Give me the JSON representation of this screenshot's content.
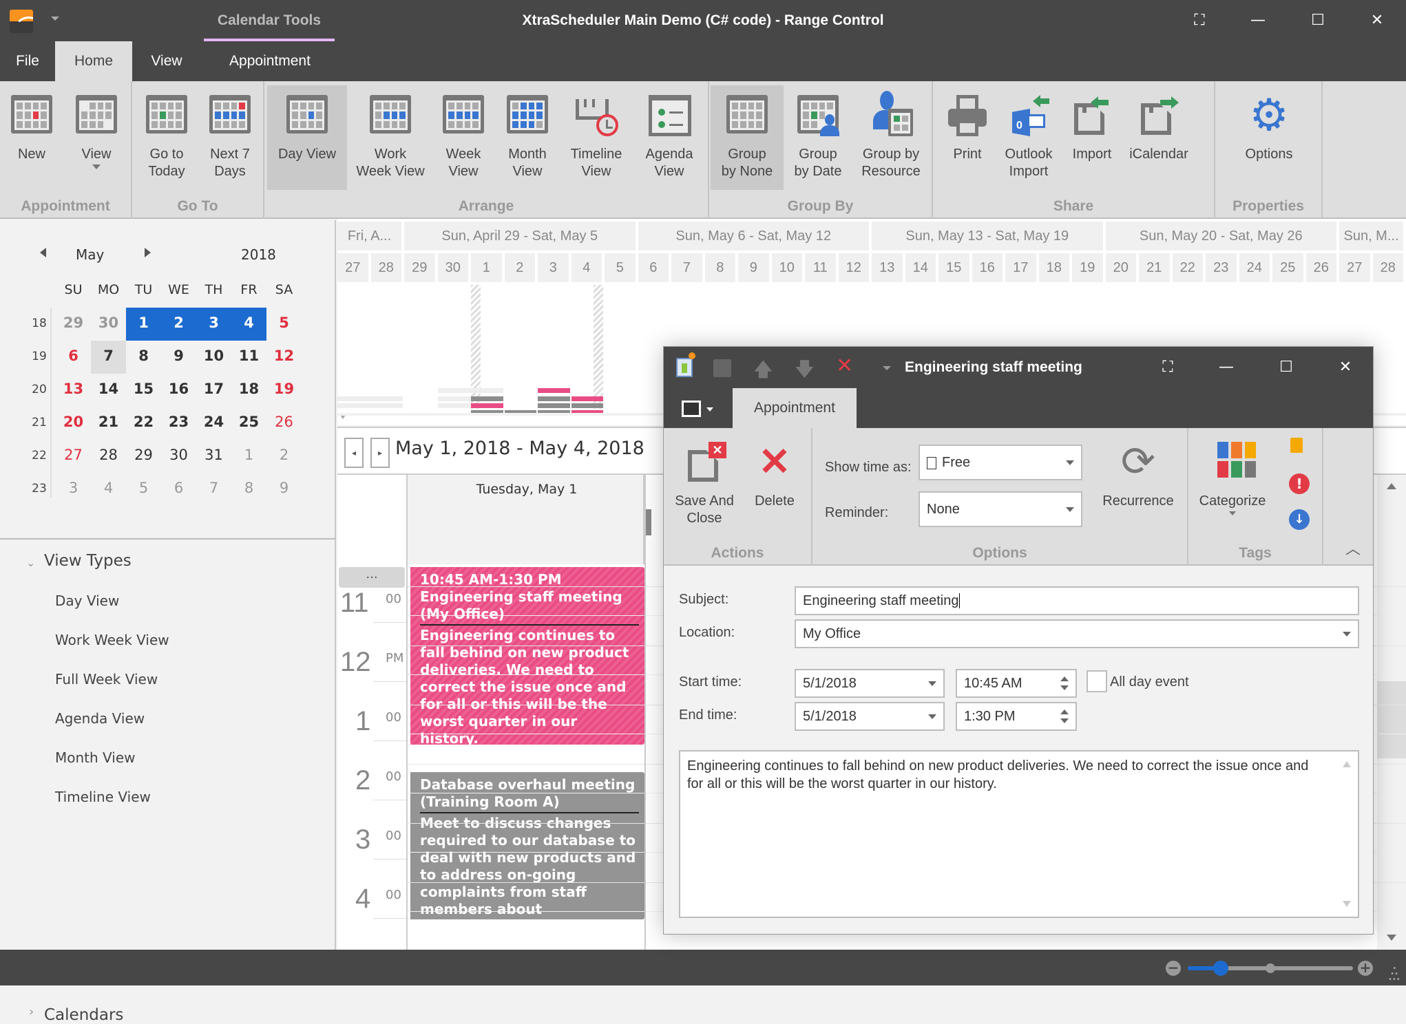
{
  "window": {
    "title": "XtraScheduler Main Demo (C# code) - Range Control",
    "context_tab": "Calendar Tools",
    "controls": {
      "focus": "⛶",
      "minimize": "—",
      "maximize": "☐",
      "close": "✕"
    }
  },
  "menu_tabs": [
    "File",
    "Home",
    "View",
    "Appointment"
  ],
  "ribbon": {
    "groups": [
      {
        "label": "Appointment",
        "buttons": [
          "New",
          "View"
        ]
      },
      {
        "label": "Go To",
        "buttons": [
          "Go to\nToday",
          "Next 7\nDays"
        ]
      },
      {
        "label": "Arrange",
        "buttons": [
          "Day View",
          "Work\nWeek View",
          "Week\nView",
          "Month\nView",
          "Timeline\nView",
          "Agenda\nView"
        ]
      },
      {
        "label": "Group By",
        "buttons": [
          "Group\nby None",
          "Group\nby Date",
          "Group by\nResource"
        ]
      },
      {
        "label": "Share",
        "buttons": [
          "Print",
          "Outlook\nImport",
          "Import",
          "iCalendar"
        ]
      },
      {
        "label": "Properties",
        "buttons": [
          "Options"
        ]
      }
    ],
    "selected": [
      "Day View",
      "Group by None"
    ]
  },
  "date_navigator": {
    "month": "May",
    "year": "2018",
    "weekdays": [
      "SU",
      "MO",
      "TU",
      "WE",
      "TH",
      "FR",
      "SA"
    ],
    "weeks": [
      {
        "num": "18",
        "days": [
          "29",
          "30",
          "1",
          "2",
          "3",
          "4",
          "5"
        ]
      },
      {
        "num": "19",
        "days": [
          "6",
          "7",
          "8",
          "9",
          "10",
          "11",
          "12"
        ]
      },
      {
        "num": "20",
        "days": [
          "13",
          "14",
          "15",
          "16",
          "17",
          "18",
          "19"
        ]
      },
      {
        "num": "21",
        "days": [
          "20",
          "21",
          "22",
          "23",
          "24",
          "25",
          "26"
        ]
      },
      {
        "num": "22",
        "days": [
          "27",
          "28",
          "29",
          "30",
          "31",
          "1",
          "2"
        ]
      },
      {
        "num": "23",
        "days": [
          "3",
          "4",
          "5",
          "6",
          "7",
          "8",
          "9"
        ]
      }
    ],
    "selected_range": "May 1 - May 4",
    "today": "7"
  },
  "nav_bar": {
    "view_types_label": "View Types",
    "view_types": [
      "Day View",
      "Work Week View",
      "Full Week View",
      "Agenda View",
      "Month View",
      "Timeline View"
    ],
    "calendars_label": "Calendars"
  },
  "range_control": {
    "week_headers": [
      "Fri, A...",
      "Sun, April 29 - Sat, May 5",
      "Sun, May 6 - Sat, May 12",
      "Sun, May 13 - Sat, May 19",
      "Sun, May 20 - Sat, May 26",
      "Sun, M..."
    ],
    "days": [
      "27",
      "28",
      "29",
      "30",
      "1",
      "2",
      "3",
      "4",
      "5",
      "6",
      "7",
      "8",
      "9",
      "10",
      "11",
      "12",
      "13",
      "14",
      "15",
      "16",
      "17",
      "18",
      "19",
      "20",
      "21",
      "22",
      "23",
      "24",
      "25",
      "26",
      "27",
      "28"
    ]
  },
  "scheduler": {
    "date_range": "May 1, 2018 - May 4, 2018",
    "day_header": "Tuesday, May 1",
    "more_button": "...",
    "hours": [
      {
        "h": "11",
        "m": "00"
      },
      {
        "h": "12",
        "m": "PM"
      },
      {
        "h": "1",
        "m": "00"
      },
      {
        "h": "2",
        "m": "00"
      },
      {
        "h": "3",
        "m": "00"
      },
      {
        "h": "4",
        "m": "00"
      }
    ],
    "appointments": [
      {
        "subject": "10:45 AM-1:30 PM Engineering staff meeting (My Office)",
        "description": "Engineering continues to fall behind on new product deliveries. We need to correct the issue once and for all or this will be the worst quarter in our history.",
        "color": "#e94c84"
      },
      {
        "subject": "Database overhaul meeting (Training Room A)",
        "description": "Meet to discuss changes required to our database to deal with new products and to address on-going complaints from staff members about performance.",
        "color": "#949494"
      }
    ]
  },
  "status_bar": {
    "zoom_level": 0.2
  },
  "dialog": {
    "title": "Engineering staff meeting",
    "tab": "Appointment",
    "ribbon": {
      "actions_label": "Actions",
      "save_close": "Save And\nClose",
      "delete": "Delete",
      "options_label": "Options",
      "show_time_as_label": "Show time as:",
      "show_time_as": "Free",
      "reminder_label": "Reminder:",
      "reminder": "None",
      "recurrence": "Recurrence",
      "tags_label": "Tags",
      "categorize": "Categorize"
    },
    "form": {
      "subject_label": "Subject:",
      "subject": "Engineering staff meeting",
      "location_label": "Location:",
      "location": "My Office",
      "start_label": "Start time:",
      "start_date": "5/1/2018",
      "start_time": "10:45 AM",
      "all_day_label": "All day event",
      "all_day": false,
      "end_label": "End time:",
      "end_date": "5/1/2018",
      "end_time": "1:30 PM",
      "notes": "Engineering continues to fall behind on new product deliveries. We need to correct the issue once and for all or this will be the worst quarter in our history."
    }
  }
}
